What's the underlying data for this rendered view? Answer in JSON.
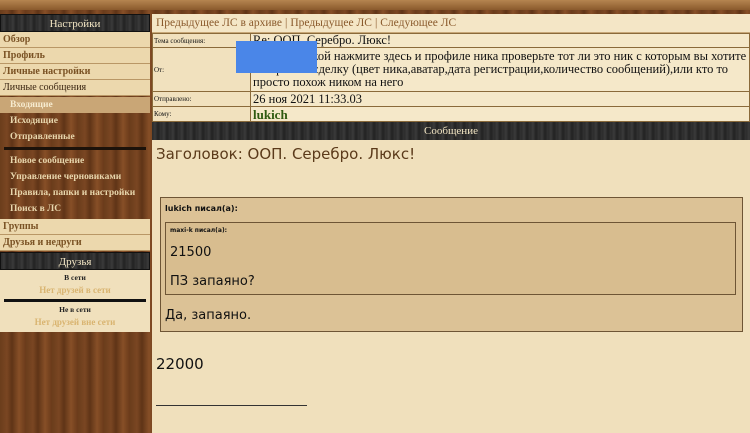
{
  "sidebar": {
    "settings_title": "Настройки",
    "menu_top": [
      "Обзор",
      "Профиль",
      "Личные настройки"
    ],
    "pm_title": "Личные сообщения",
    "pm_items": [
      "Входящие",
      "Исходящие",
      "Отправленные"
    ],
    "pm_items2": [
      "Новое сообщение",
      "Управление черновиками",
      "Правила, папки и настройки",
      "Поиск в ЛС"
    ],
    "menu_bottom": [
      "Группы",
      "Друзья и недруги"
    ],
    "friends_title": "Друзья",
    "online_label": "В сети",
    "online_value": "Нет друзей в сети",
    "offline_label": "Не в сети",
    "offline_value": "Нет друзей вне сети"
  },
  "nav": {
    "archive_prev": "Предыдущее ЛС в архиве",
    "prev": "Предыдущее ЛС",
    "next": "Следующее ЛС",
    "separator": "|"
  },
  "info": {
    "subject_label": "Тема сообщения:",
    "subject_value": "Re: ООП. Серебро. Люкс!",
    "from_label": "От:",
    "from_value": "Перед сделкой нажмите здесь и профиле ника проверьте тот ли это ник с которым вы хотите совершить сделку (цвет ника,аватар,дата регистрации,количество сообщений),или кто то просто похож ником на него",
    "sent_label": "Отправлено:",
    "sent_value": "26 ноя 2021 11:33.03",
    "to_label": "Кому:",
    "to_value": "lukich"
  },
  "message": {
    "header": "Сообщение",
    "subject": "Заголовок: ООП. Серебро. Люкс!",
    "quote_author": "lukich писал(а):",
    "inner_author": "maxi-k писал(а):",
    "inner_line1": "21500",
    "inner_line2": "ПЗ запаяно?",
    "reply": "Да, запаяно.",
    "after_quote": "22000"
  },
  "colors": {
    "panel": "#f0e0bc",
    "link": "#8a5a2c",
    "username": "#2f5a10",
    "redaction": "#4a86e8"
  }
}
